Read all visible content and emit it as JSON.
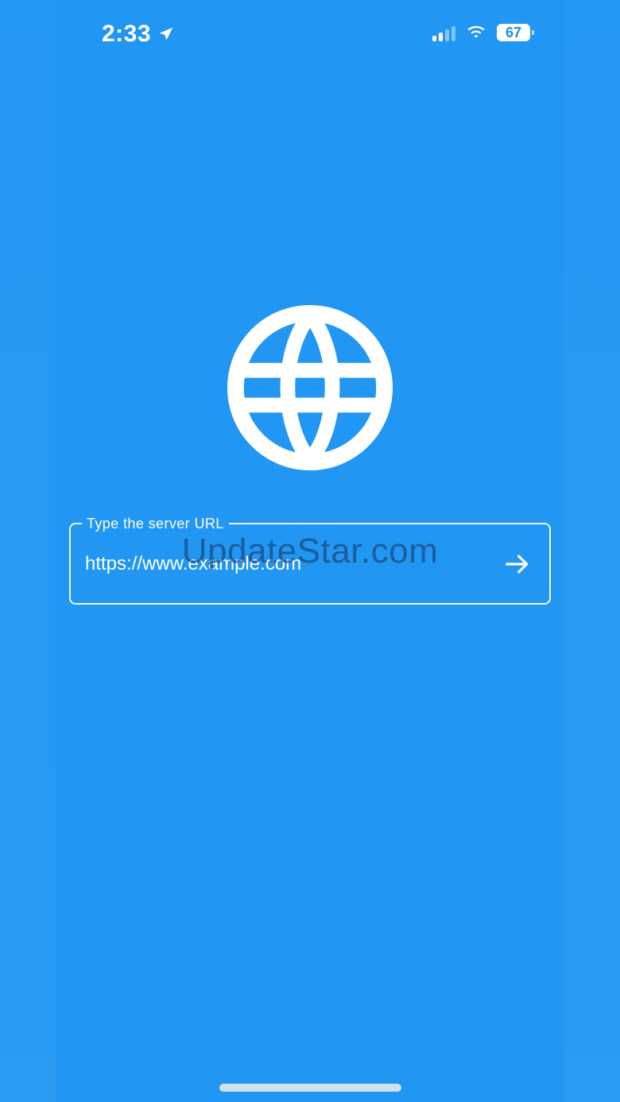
{
  "status_bar": {
    "time": "2:33",
    "battery_level": "67",
    "location_icon": "location-arrow-icon",
    "cellular_icon": "cellular-signal-icon",
    "wifi_icon": "wifi-icon"
  },
  "main": {
    "logo_icon": "globe-icon",
    "url_field": {
      "label": "Type the server URL",
      "placeholder": "https://www.example.com",
      "submit_icon": "arrow-right-icon"
    }
  },
  "watermark": "UpdateStar.com",
  "colors": {
    "background": "#2196F3",
    "foreground": "#FFFFFF"
  }
}
